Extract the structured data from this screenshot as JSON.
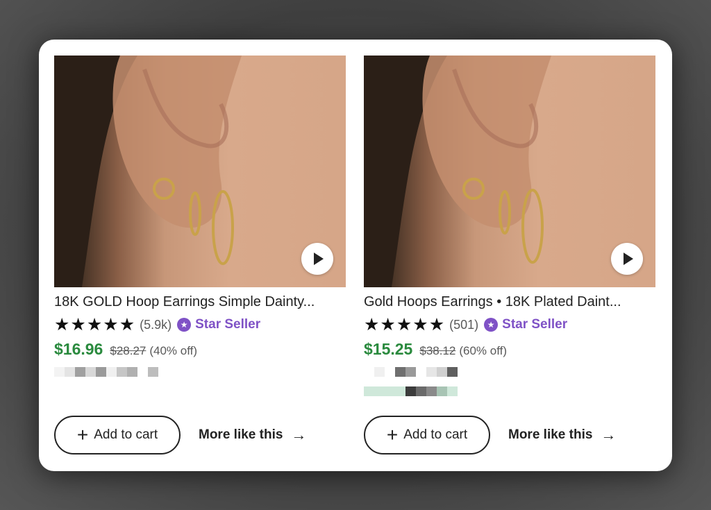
{
  "listings": [
    {
      "title": "18K GOLD Hoop Earrings Simple Dainty...",
      "review_count": "(5.9k)",
      "rating_stars": 5,
      "badge": "Star Seller",
      "price": "$16.96",
      "original_price": "$28.27",
      "discount": "(40% off)",
      "add_to_cart_label": "Add to cart",
      "more_like_label": "More like this"
    },
    {
      "title": "Gold Hoops Earrings • 18K Plated Daint...",
      "review_count": "(501)",
      "rating_stars": 5,
      "badge": "Star Seller",
      "price": "$15.25",
      "original_price": "$38.12",
      "discount": "(60% off)",
      "add_to_cart_label": "Add to cart",
      "more_like_label": "More like this"
    }
  ],
  "icons": {
    "star": "star-icon",
    "badge": "star-seller-badge-icon",
    "play": "play-icon",
    "plus": "plus-icon",
    "arrow": "arrow-right-icon"
  },
  "colors": {
    "price": "#2a8a3e",
    "badge": "#7f52c6",
    "text": "#222222"
  }
}
